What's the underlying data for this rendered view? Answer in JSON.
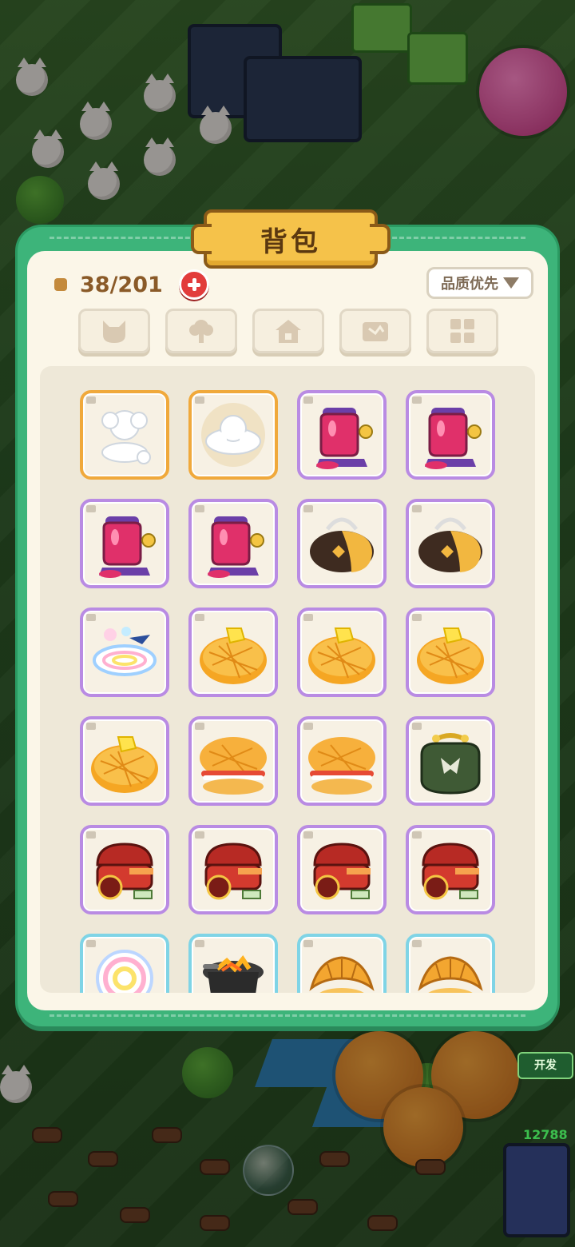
{
  "panel": {
    "title": "背包",
    "capacity": "38/201",
    "sort_label": "品质优先"
  },
  "tabs": [
    {
      "icon": "cat-icon"
    },
    {
      "icon": "tree-icon"
    },
    {
      "icon": "house-icon"
    },
    {
      "icon": "map-icon"
    },
    {
      "icon": "grid-icon"
    }
  ],
  "items": [
    {
      "kind": "cloud-statue",
      "rarity": "gold"
    },
    {
      "kind": "cloud-cat",
      "rarity": "gold"
    },
    {
      "kind": "jam-machine",
      "rarity": "purple"
    },
    {
      "kind": "jam-machine",
      "rarity": "purple"
    },
    {
      "kind": "jam-machine",
      "rarity": "purple"
    },
    {
      "kind": "jam-machine",
      "rarity": "purple"
    },
    {
      "kind": "travel-bag",
      "rarity": "purple"
    },
    {
      "kind": "travel-bag",
      "rarity": "purple"
    },
    {
      "kind": "rainbow-cloud",
      "rarity": "purple"
    },
    {
      "kind": "pineapple-bun",
      "rarity": "purple"
    },
    {
      "kind": "pineapple-bun",
      "rarity": "purple"
    },
    {
      "kind": "pineapple-bun",
      "rarity": "purple"
    },
    {
      "kind": "pineapple-bun",
      "rarity": "purple"
    },
    {
      "kind": "bun-sandwich",
      "rarity": "purple"
    },
    {
      "kind": "bun-sandwich",
      "rarity": "purple"
    },
    {
      "kind": "coin-purse",
      "rarity": "purple"
    },
    {
      "kind": "bbq-grill",
      "rarity": "purple"
    },
    {
      "kind": "bbq-grill",
      "rarity": "purple"
    },
    {
      "kind": "bbq-grill",
      "rarity": "purple"
    },
    {
      "kind": "bbq-grill",
      "rarity": "purple"
    },
    {
      "kind": "rainbow-orb",
      "rarity": "blue"
    },
    {
      "kind": "charcoal-pot",
      "rarity": "blue"
    },
    {
      "kind": "croissant",
      "rarity": "blue"
    },
    {
      "kind": "croissant",
      "rarity": "blue"
    }
  ],
  "hud": {
    "dev_label": "开发",
    "counter": "12788"
  },
  "colors": {
    "panel_green": "#3db47a",
    "rarity_gold": "#f0a93b",
    "rarity_purple": "#b98be3",
    "rarity_blue": "#7fd4e6"
  }
}
